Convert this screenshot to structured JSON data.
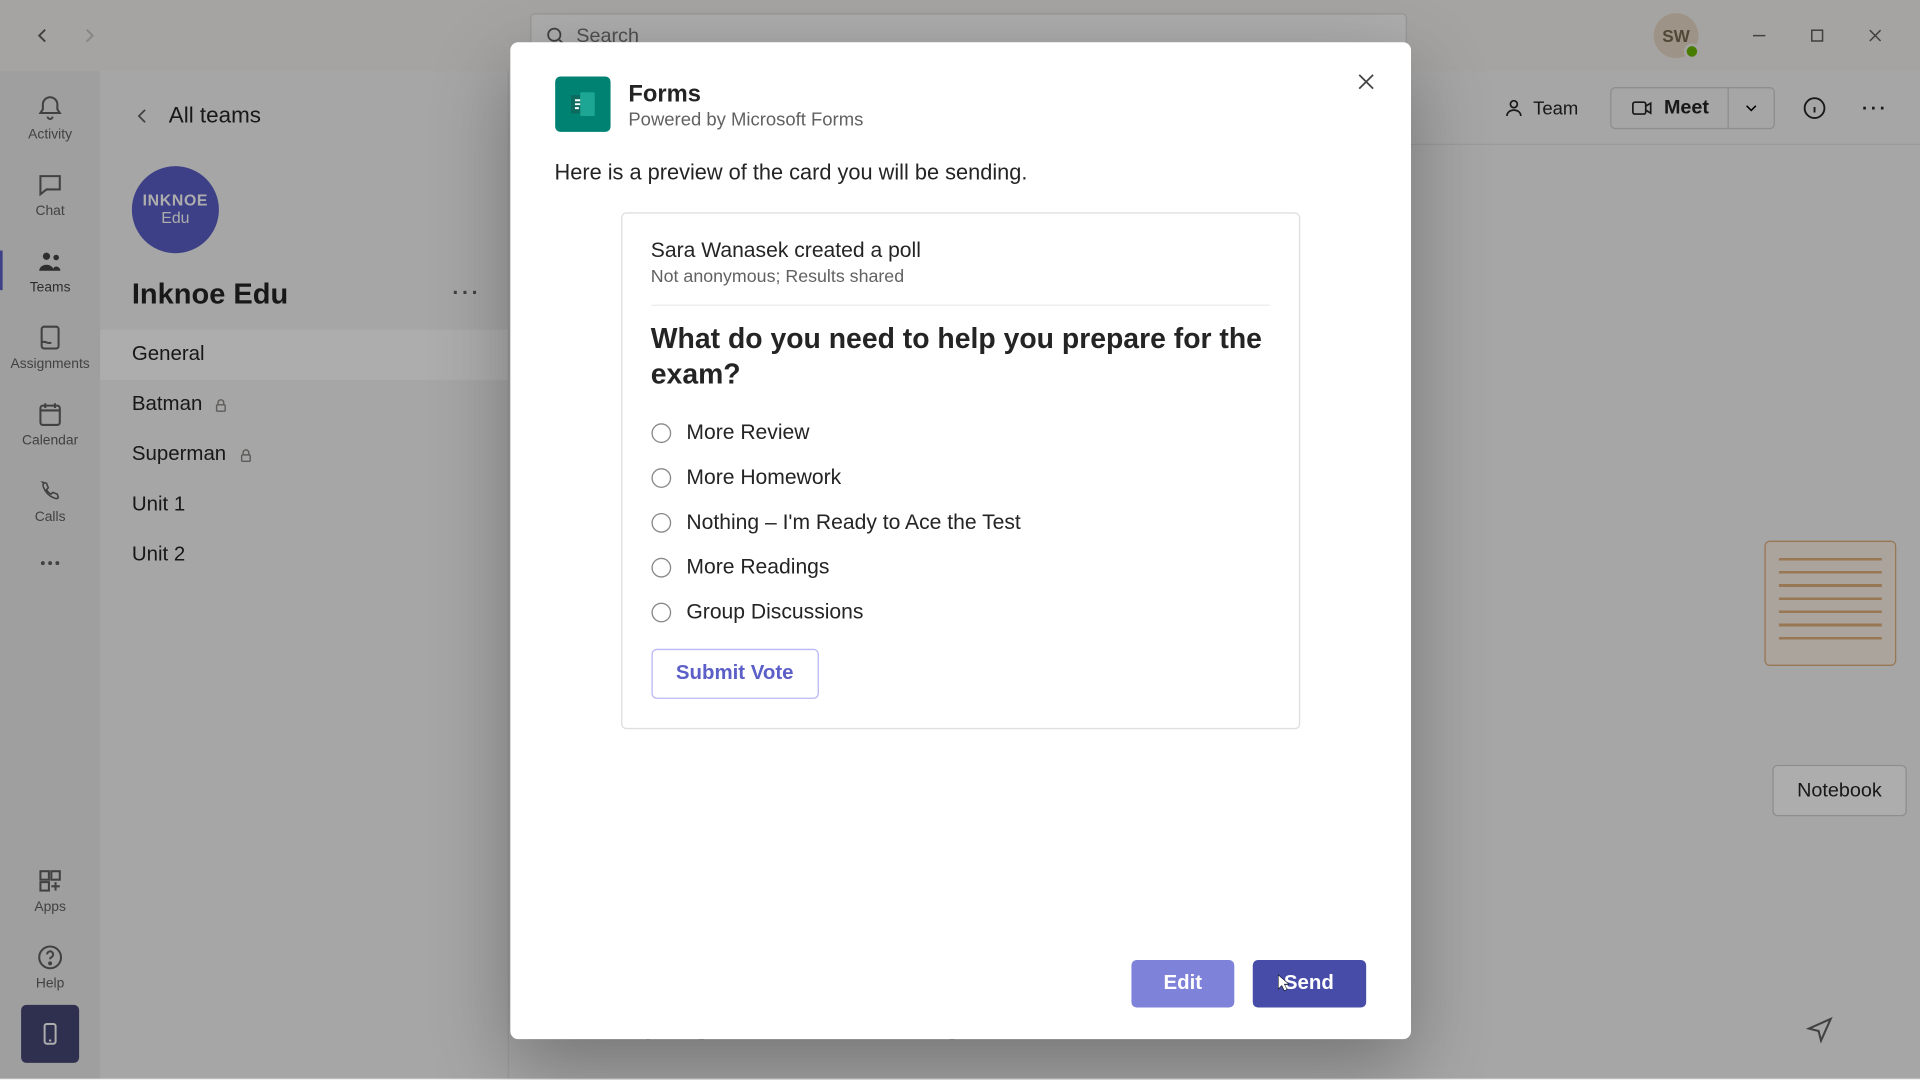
{
  "titlebar": {
    "search_placeholder": "Search",
    "avatar_initials": "SW"
  },
  "rail": {
    "activity": "Activity",
    "chat": "Chat",
    "teams": "Teams",
    "assignments": "Assignments",
    "calendar": "Calendar",
    "calls": "Calls",
    "apps": "Apps",
    "help": "Help"
  },
  "sidebar": {
    "all_teams": "All teams",
    "team_logo_line1": "INKNOE",
    "team_logo_line2": "Edu",
    "team_name": "Inknoe Edu",
    "channels": [
      {
        "label": "General",
        "locked": false,
        "active": true
      },
      {
        "label": "Batman",
        "locked": true,
        "active": false
      },
      {
        "label": "Superman",
        "locked": true,
        "active": false
      },
      {
        "label": "Unit 1",
        "locked": false,
        "active": false
      },
      {
        "label": "Unit 2",
        "locked": false,
        "active": false
      }
    ]
  },
  "channel_header": {
    "team_btn": "Team",
    "meet_btn": "Meet"
  },
  "content": {
    "open_notebook": "Notebook"
  },
  "modal": {
    "title": "Forms",
    "subtitle": "Powered by Microsoft Forms",
    "intro": "Here is a preview of the card you will be sending.",
    "card": {
      "creator_line": "Sara Wanasek created a poll",
      "meta_line": "Not anonymous; Results shared",
      "question": "What do you need to help you prepare for the exam?",
      "options": [
        "More Review",
        "More Homework",
        "Nothing – I'm Ready to Ace the Test",
        "More Readings",
        "Group Discussions"
      ],
      "submit_label": "Submit Vote"
    },
    "edit_label": "Edit",
    "send_label": "Send"
  }
}
